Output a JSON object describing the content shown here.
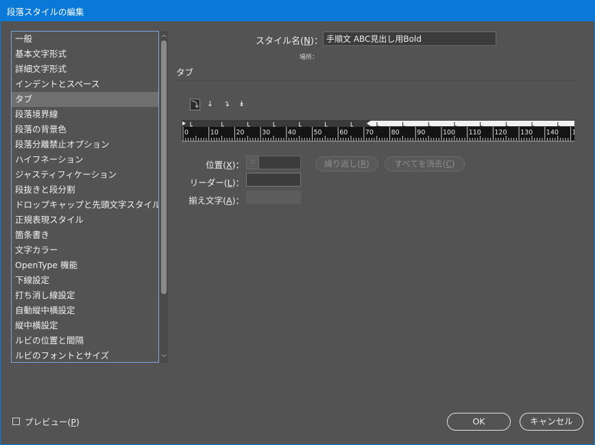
{
  "window": {
    "title": "段落スタイルの編集"
  },
  "categories": [
    "一般",
    "基本文字形式",
    "詳細文字形式",
    "インデントとスペース",
    "タブ",
    "段落境界線",
    "段落の背景色",
    "段落分離禁止オプション",
    "ハイフネーション",
    "ジャスティフィケーション",
    "段抜きと段分割",
    "ドロップキャップと先頭文字スタイル",
    "正規表現スタイル",
    "箇条書き",
    "文字カラー",
    "OpenType 機能",
    "下線設定",
    "打ち消し線設定",
    "自動縦中横設定",
    "縦中横設定",
    "ルビの位置と間隔",
    "ルビのフォントとサイズ"
  ],
  "selected_category": "タブ",
  "style_name": {
    "label_prefix": "スタイル名(",
    "label_key": "N",
    "label_suffix": ")：",
    "value": "手順文 ABC見出し用Bold"
  },
  "location_label": "場所：",
  "section_title": "タブ",
  "tab_buttons": [
    {
      "name": "left-justified-tab",
      "glyph": "⤵",
      "active": true
    },
    {
      "name": "center-justified-tab",
      "glyph": "↓",
      "active": false
    },
    {
      "name": "right-justified-tab",
      "glyph": "↴",
      "active": false
    },
    {
      "name": "align-to-decimal-tab",
      "glyph": "↡",
      "active": false
    }
  ],
  "ruler": {
    "labels": [
      "0",
      "10",
      "20",
      "30",
      "40",
      "50",
      "60",
      "70",
      "80",
      "90",
      "100",
      "110",
      "120",
      "130",
      "140",
      "1"
    ],
    "right_indent_at": 70
  },
  "fields": {
    "position": {
      "prefix": "位置(",
      "key": "X",
      "suffix": ")：",
      "value": ""
    },
    "leader": {
      "prefix": "リーダー(",
      "key": "L",
      "suffix": ")：",
      "value": ""
    },
    "align_on": {
      "prefix": "揃え文字(",
      "key": "A",
      "suffix": ")：",
      "value": ""
    }
  },
  "buttons": {
    "repeat": {
      "prefix": "繰り返し(",
      "key": "R",
      "suffix": ")"
    },
    "clear_all": {
      "prefix": "すべてを消去(",
      "key": "C",
      "suffix": ")"
    },
    "preview": {
      "prefix": "プレビュー(",
      "key": "P",
      "suffix": ")",
      "checked": false
    },
    "ok": "OK",
    "cancel": "キャンセル"
  },
  "colors": {
    "titlebar": "#0a78d7",
    "dialog_bg": "#535353",
    "selection": "#6f6f6f"
  }
}
